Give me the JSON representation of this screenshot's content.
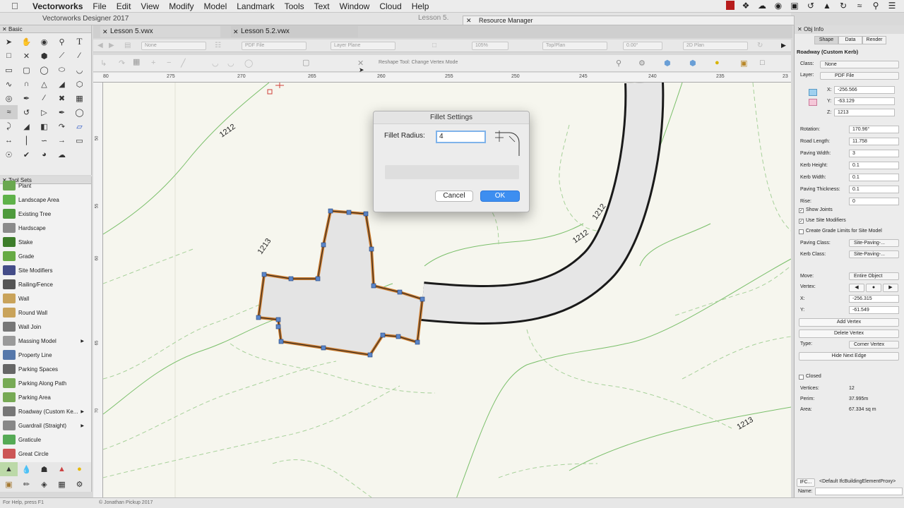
{
  "menubar": {
    "app_name": "Vectorworks",
    "items": [
      "File",
      "Edit",
      "View",
      "Modify",
      "Model",
      "Landmark",
      "Tools",
      "Text",
      "Window",
      "Cloud",
      "Help"
    ]
  },
  "window": {
    "title": "Vectorworks Designer 2017",
    "ghost_title": "Lesson 5.",
    "resource_manager": "Resource Manager"
  },
  "tabs": [
    {
      "label": "Lesson 5.vwx"
    },
    {
      "label": "Lesson 5.2.vwx"
    }
  ],
  "viewbar": {
    "class": "None",
    "layer_set": "PDF File",
    "plane": "Layer Plane",
    "zoom": "105%",
    "view": "Top/Plan",
    "angle": "0.00°",
    "render": "2D Plan"
  },
  "modebar": {
    "hint": "Reshape Tool: Change Vertex Mode"
  },
  "rulers": {
    "top": [
      "80",
      "275",
      "270",
      "265",
      "260",
      "255",
      "250",
      "245",
      "240",
      "235",
      "23"
    ],
    "left": [
      "50",
      "55",
      "60",
      "65",
      "70"
    ]
  },
  "palettes": {
    "basic_title": "Basic",
    "toolsets_title": "Tool Sets",
    "toolsets": [
      {
        "label": "Plant",
        "color": "#6aa84f"
      },
      {
        "label": "Landscape Area",
        "color": "#5fb24a"
      },
      {
        "label": "Existing Tree",
        "color": "#4e9a3c"
      },
      {
        "label": "Hardscape",
        "color": "#8b8b8b"
      },
      {
        "label": "Stake",
        "color": "#3d7d2a"
      },
      {
        "label": "Grade",
        "color": "#66aa44"
      },
      {
        "label": "Site Modifiers",
        "color": "#444c88"
      },
      {
        "label": "Railing/Fence",
        "color": "#555555"
      },
      {
        "label": "Wall",
        "color": "#c9a35a"
      },
      {
        "label": "Round Wall",
        "color": "#c9a35a"
      },
      {
        "label": "Wall Join",
        "color": "#777777"
      },
      {
        "label": "Massing Model",
        "color": "#9a9a9a",
        "submenu": true
      },
      {
        "label": "Property Line",
        "color": "#5577aa"
      },
      {
        "label": "Parking Spaces",
        "color": "#666666"
      },
      {
        "label": "Parking Along Path",
        "color": "#77aa55"
      },
      {
        "label": "Parking Area",
        "color": "#77aa55"
      },
      {
        "label": "Roadway (Custom Ke...",
        "color": "#777777",
        "submenu": true
      },
      {
        "label": "Guardrail (Straight)",
        "color": "#888888",
        "submenu": true
      },
      {
        "label": "Graticule",
        "color": "#55aa55"
      },
      {
        "label": "Great Circle",
        "color": "#cc5555"
      }
    ]
  },
  "status": {
    "help": "For Help, press F1",
    "copyright": "© Jonathan Pickup 2017"
  },
  "canvas": {
    "contour_labels": [
      "1212",
      "1213",
      "1212",
      "1212",
      "1213"
    ]
  },
  "dialog": {
    "title": "Fillet Settings",
    "radius_label": "Fillet Radius:",
    "radius_value": "4",
    "cancel": "Cancel",
    "ok": "OK"
  },
  "objinfo": {
    "title": "Obj Info",
    "tabs": [
      "Shape",
      "Data",
      "Render"
    ],
    "object_type": "Roadway (Custom Kerb)",
    "class_label": "Class:",
    "class_value": "None",
    "layer_label": "Layer:",
    "layer_value": "PDF File",
    "x_label": "X:",
    "x_value": "-256.566",
    "y_label": "Y:",
    "y_value": "-63.129",
    "z_label": "Z:",
    "z_value": "1213",
    "fields": [
      {
        "label": "Rotation:",
        "value": "170.96°"
      },
      {
        "label": "Road Length:",
        "value": "11.758"
      },
      {
        "label": "Paving Width:",
        "value": "3"
      },
      {
        "label": "Kerb Height:",
        "value": "0.1"
      },
      {
        "label": "Kerb Width:",
        "value": "0.1"
      },
      {
        "label": "Paving Thickness:",
        "value": "0.1"
      },
      {
        "label": "Rise:",
        "value": "0"
      }
    ],
    "show_joints": "Show Joints",
    "use_site_modifiers": "Use Site Modifiers",
    "create_grade_limits": "Create Grade Limits for Site Model",
    "paving_class_label": "Paving Class:",
    "paving_class_value": "Site-Paving-...",
    "kerb_class_label": "Kerb Class:",
    "kerb_class_value": "Site-Paving-...",
    "move_label": "Move:",
    "move_value": "Entire Object",
    "vertex_label": "Vertex:",
    "vx_label": "X:",
    "vx_value": "-256.315",
    "vy_label": "Y:",
    "vy_value": "-61.549",
    "add_vertex": "Add Vertex",
    "delete_vertex": "Delete Vertex",
    "type_label": "Type:",
    "type_value": "Corner Vertex",
    "hide_next_edge": "Hide Next Edge",
    "closed": "Closed",
    "vertices_label": "Vertices:",
    "vertices_value": "12",
    "perim_label": "Perim:",
    "perim_value": "37.995m",
    "area_label": "Area:",
    "area_value": "67.334 sq m",
    "ifc_button": "IFC...",
    "ifc_value": "<Default IfcBuildingElementProxy>",
    "name_label": "Name:"
  }
}
